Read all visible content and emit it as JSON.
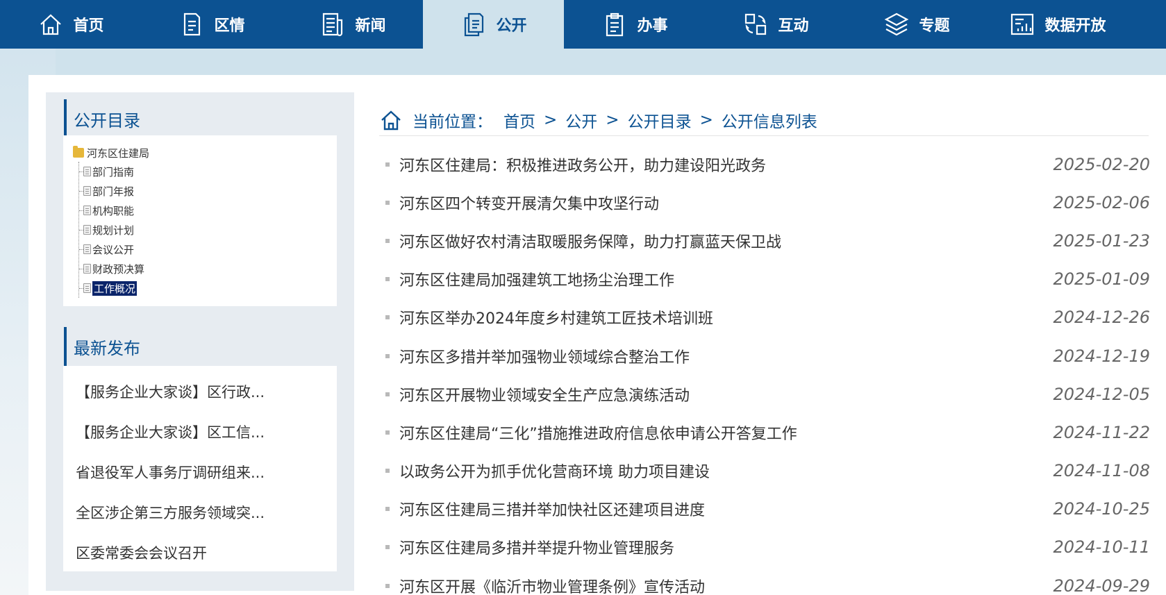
{
  "nav": {
    "items": [
      {
        "label": "首页",
        "icon": "home-icon"
      },
      {
        "label": "区情",
        "icon": "document-icon"
      },
      {
        "label": "新闻",
        "icon": "news-icon"
      },
      {
        "label": "公开",
        "icon": "files-icon",
        "active": true
      },
      {
        "label": "办事",
        "icon": "clipboard-icon"
      },
      {
        "label": "互动",
        "icon": "interact-icon"
      },
      {
        "label": "专题",
        "icon": "layers-icon"
      },
      {
        "label": "数据开放",
        "icon": "data-icon"
      }
    ]
  },
  "sidebar": {
    "catalog_title": "公开目录",
    "tree": {
      "root": "河东区住建局",
      "children": [
        "部门指南",
        "部门年报",
        "机构职能",
        "规划计划",
        "会议公开",
        "财政预决算",
        "工作概况"
      ],
      "selected": "工作概况"
    },
    "latest_title": "最新发布",
    "latest": [
      "【服务企业大家谈】区行政...",
      "【服务企业大家谈】区工信...",
      "省退役军人事务厅调研组来...",
      "全区涉企第三方服务领域突...",
      "区委常委会会议召开"
    ]
  },
  "breadcrumb": {
    "label": "当前位置：",
    "items": [
      "首页",
      "公开",
      "公开目录",
      "公开信息列表"
    ],
    "separator": ">"
  },
  "news": [
    {
      "title": "河东区住建局：积极推进政务公开，助力建设阳光政务",
      "date": "2025-02-20"
    },
    {
      "title": "河东区四个转变开展清欠集中攻坚行动",
      "date": "2025-02-06"
    },
    {
      "title": "河东区做好农村清洁取暖服务保障，助力打赢蓝天保卫战",
      "date": "2025-01-23"
    },
    {
      "title": "河东区住建局加强建筑工地扬尘治理工作",
      "date": "2025-01-09"
    },
    {
      "title": "河东区举办2024年度乡村建筑工匠技术培训班",
      "date": "2024-12-26"
    },
    {
      "title": "河东区多措并举加强物业领域综合整治工作",
      "date": "2024-12-19"
    },
    {
      "title": "河东区开展物业领域安全生产应急演练活动",
      "date": "2024-12-05"
    },
    {
      "title": "河东区住建局“三化”措施推进政府信息依申请公开答复工作",
      "date": "2024-11-22"
    },
    {
      "title": "以政务公开为抓手优化营商环境 助力项目建设",
      "date": "2024-11-08"
    },
    {
      "title": "河东区住建局三措并举加快社区还建项目进度",
      "date": "2024-10-25"
    },
    {
      "title": "河东区住建局多措并举提升物业管理服务",
      "date": "2024-10-11"
    },
    {
      "title": "河东区开展《临沂市物业管理条例》宣传活动",
      "date": "2024-09-29"
    }
  ],
  "colors": {
    "primary": "#0c5292",
    "active_tab_bg": "#cfe2ec",
    "sidebar_bg": "#e7ecf1",
    "selected_bg": "#0a246a"
  }
}
